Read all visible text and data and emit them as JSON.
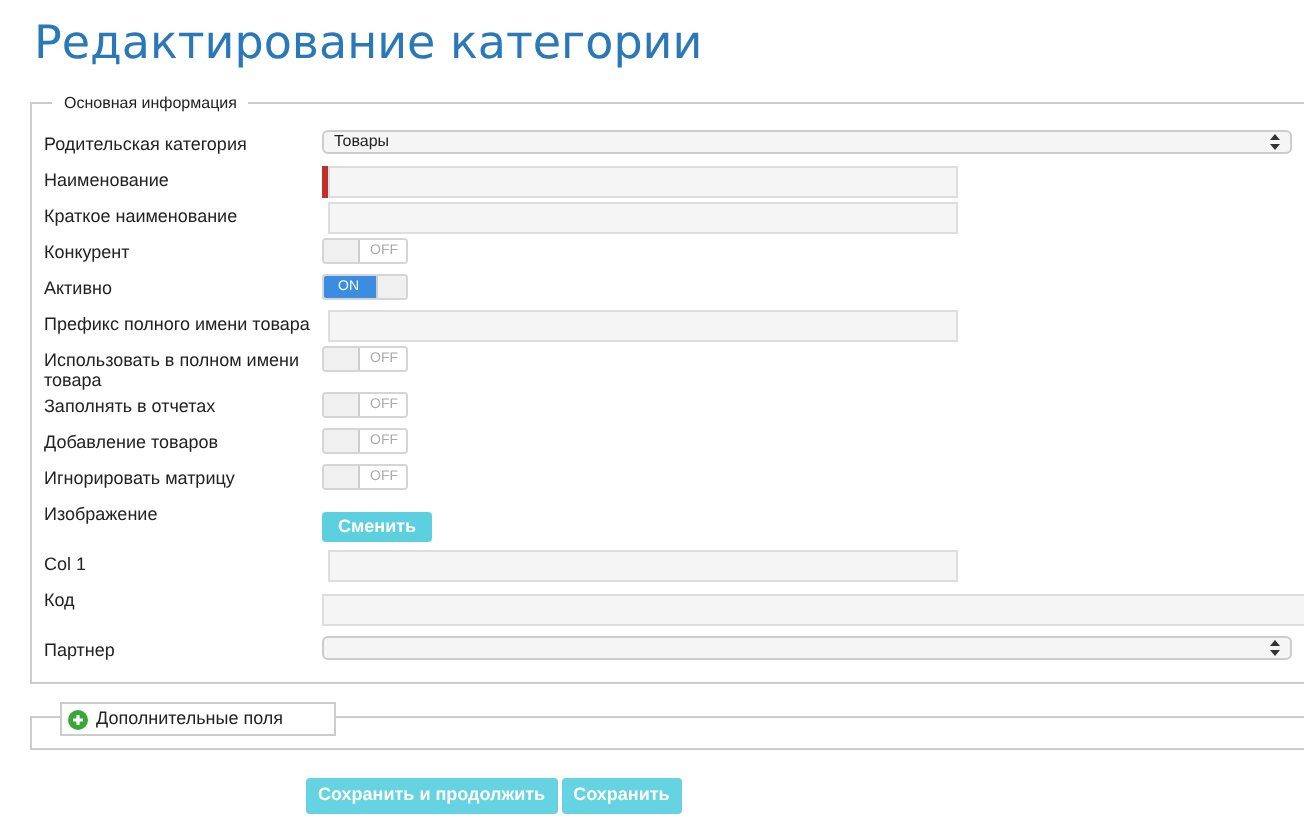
{
  "title": "Редактирование категории",
  "main_section": {
    "legend": "Основная информация",
    "fields": [
      {
        "label": "Родительская категория",
        "kind": "select",
        "value": "Товары"
      },
      {
        "label": "Наименование",
        "kind": "input",
        "required": true
      },
      {
        "label": "Краткое наименование",
        "kind": "input",
        "required": false
      },
      {
        "label": "Конкурент",
        "kind": "toggle",
        "on": false,
        "toggle_text": "OFF"
      },
      {
        "label": "Активно",
        "kind": "toggle",
        "on": true,
        "toggle_text": "ON"
      },
      {
        "label": "Префикс полного имени товара",
        "kind": "input",
        "required": false
      },
      {
        "label": "Использовать в полном имени товара",
        "kind": "toggle",
        "on": false,
        "toggle_text": "OFF"
      },
      {
        "label": "Заполнять в отчетах",
        "kind": "toggle",
        "on": false,
        "toggle_text": "OFF"
      },
      {
        "label": "Добавление товаров",
        "kind": "toggle",
        "on": false,
        "toggle_text": "OFF"
      },
      {
        "label": "Игнорировать матрицу",
        "kind": "toggle",
        "on": false,
        "toggle_text": "OFF"
      },
      {
        "label": "Изображение",
        "kind": "button",
        "button": "Сменить"
      },
      {
        "label": "Col 1",
        "kind": "input",
        "required": false
      },
      {
        "label": "Код",
        "kind": "wideinput"
      },
      {
        "label": "Партнер",
        "kind": "select"
      }
    ]
  },
  "extra_section": {
    "legend": "Дополнительные поля",
    "expanded": false
  },
  "buttons": [
    "Сохранить и продолжить",
    "Сохранить"
  ]
}
